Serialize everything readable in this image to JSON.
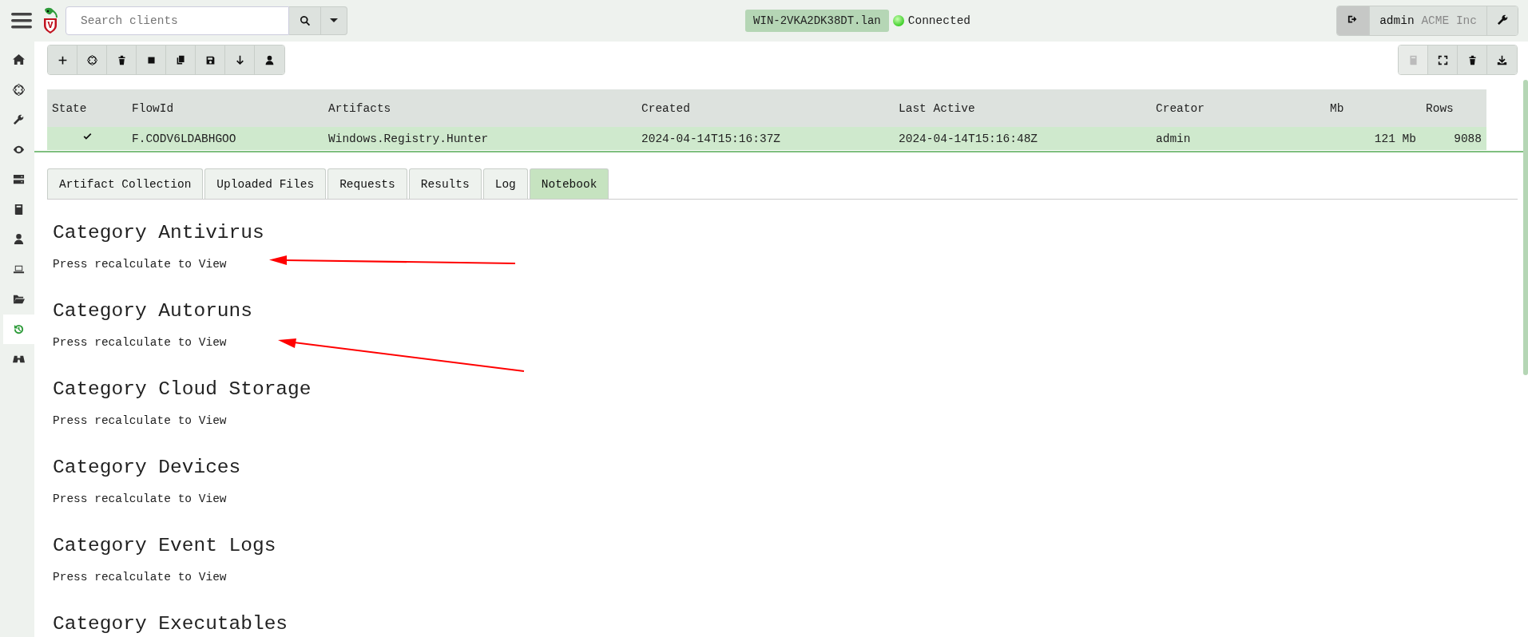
{
  "topbar": {
    "search": {
      "placeholder": "Search clients"
    },
    "client": "WIN-2VKA2DK38DT.lan",
    "connection": {
      "status": "Connected",
      "online": true
    },
    "user": "admin",
    "org": "ACME Inc"
  },
  "sidebar": {
    "items": [
      {
        "selected": false
      },
      {
        "selected": false
      },
      {
        "selected": false
      },
      {
        "selected": false
      },
      {
        "selected": false
      },
      {
        "selected": false
      },
      {
        "selected": false
      },
      {
        "selected": false
      },
      {
        "selected": false
      },
      {
        "selected": true
      },
      {
        "selected": false
      }
    ]
  },
  "right_toolbar": {
    "buttons": [
      {
        "disabled": true
      },
      {
        "disabled": false
      },
      {
        "disabled": false
      },
      {
        "disabled": false
      }
    ]
  },
  "table": {
    "columns": [
      "State",
      "FlowId",
      "Artifacts",
      "Created",
      "Last Active",
      "Creator",
      "Mb",
      "Rows"
    ],
    "rows": [
      {
        "selected": true,
        "done": true,
        "cells": [
          "",
          "F.CODV6LDABHGOO",
          "Windows.Registry.Hunter",
          "2024-04-14T15:16:37Z",
          "2024-04-14T15:16:48Z",
          "admin",
          "121 Mb",
          "9088"
        ]
      }
    ]
  },
  "tabs": [
    {
      "label": "Artifact Collection",
      "selected": false
    },
    {
      "label": "Uploaded Files",
      "selected": false
    },
    {
      "label": "Requests",
      "selected": false
    },
    {
      "label": "Results",
      "selected": false
    },
    {
      "label": "Log",
      "selected": false
    },
    {
      "label": "Notebook",
      "selected": true
    }
  ],
  "notebook": {
    "sections": [
      {
        "heading": "Category Antivirus",
        "text": "Press recalculate to View"
      },
      {
        "heading": "Category Autoruns",
        "text": "Press recalculate to View"
      },
      {
        "heading": "Category Cloud Storage",
        "text": "Press recalculate to View"
      },
      {
        "heading": "Category Devices",
        "text": "Press recalculate to View"
      },
      {
        "heading": "Category Event Logs",
        "text": "Press recalculate to View"
      },
      {
        "heading": "Category Executables"
      }
    ]
  }
}
